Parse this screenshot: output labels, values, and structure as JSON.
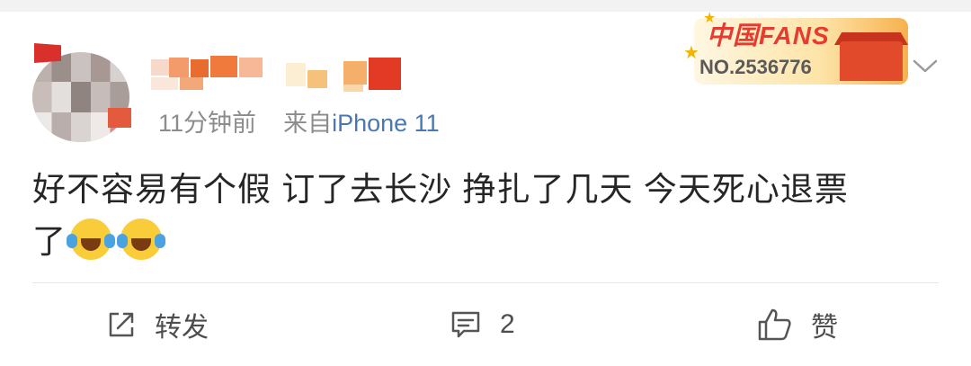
{
  "post": {
    "meta": {
      "time": "11分钟前",
      "source_prefix": "来自",
      "source": "iPhone 11"
    },
    "badge": {
      "brand": "中国FANS",
      "number": "NO.2536776"
    },
    "text_line1": "好不容易有个假 订了去长沙 挣扎了几天 今天死心退票",
    "text_line2": "了",
    "emojis": [
      "laugh-cry-icon",
      "laugh-cry-icon"
    ]
  },
  "actions": {
    "share_label": "转发",
    "comment_count": "2",
    "like_label": "赞"
  },
  "colors": {
    "meta_gray": "#8c8c8c",
    "source_blue": "#4a78b3",
    "badge_red": "#e63b2e",
    "divider": "#e6e6e6"
  }
}
